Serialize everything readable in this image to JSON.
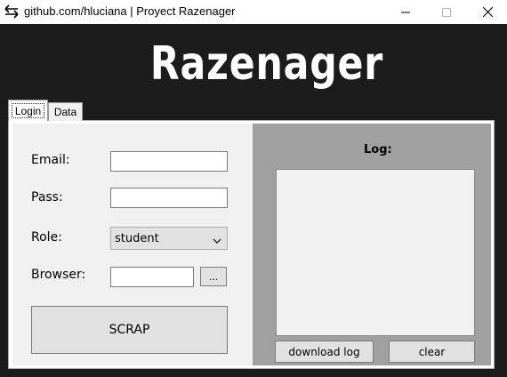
{
  "window": {
    "title": "github.com/hluciana | Proyect Razenager",
    "app_icon": "swap-arrows-icon",
    "minimize_icon": "minimize-icon",
    "maximize_icon": "maximize-icon",
    "close_icon": "close-icon"
  },
  "header": {
    "title": "Razenager"
  },
  "tabs": [
    {
      "label": "Login",
      "selected": true
    },
    {
      "label": "Data",
      "selected": false
    }
  ],
  "form": {
    "email_label": "Email:",
    "email_value": "",
    "pass_label": "Pass:",
    "pass_value": "",
    "role_label": "Role:",
    "role_value": "student",
    "browser_label": "Browser:",
    "browser_value": "",
    "browse_button_label": "...",
    "scrap_button_label": "SCRAP"
  },
  "log": {
    "label": "Log:",
    "content": "",
    "download_button_label": "download log",
    "clear_button_label": "clear"
  },
  "colors": {
    "window_background": "#1c1c1c",
    "form_background": "#f0f0f0",
    "log_background": "#a0a0a0",
    "title_color": "#ffffff"
  }
}
